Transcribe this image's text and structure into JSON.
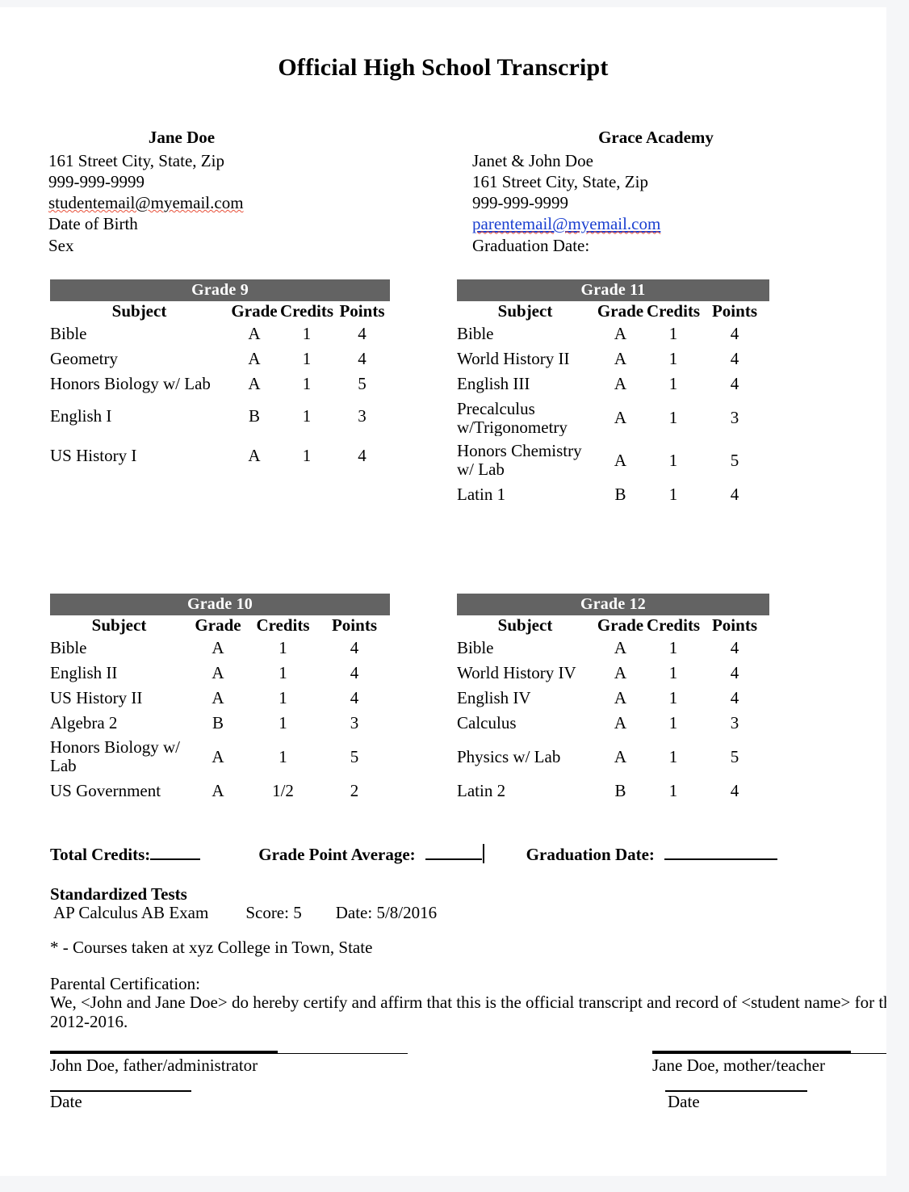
{
  "document": {
    "title": "Official High School Transcript"
  },
  "student": {
    "name": "Jane Doe",
    "address": "161 Street  City, State, Zip",
    "phone": "999-999-9999",
    "email": "studentemail@myemail.com",
    "dob_label": "Date of Birth",
    "sex_label": "Sex"
  },
  "school": {
    "name": "Grace Academy",
    "parents": "Janet & John Doe",
    "address": "161 Street  City, State, Zip",
    "phone": "999-999-9999",
    "email": "parentemail@myemail.com",
    "graduation_label": "Graduation Date:"
  },
  "columns": {
    "subject": "Subject",
    "grade": "Grade",
    "credits": "Credits",
    "points": "Points"
  },
  "grade9": {
    "title": "Grade 9",
    "rows": [
      {
        "subject": "Bible",
        "grade": "A",
        "credits": "1",
        "points": "4"
      },
      {
        "subject": "Geometry",
        "grade": "A",
        "credits": "1",
        "points": "4"
      },
      {
        "subject": "Honors Biology w/ Lab",
        "grade": "A",
        "credits": "1",
        "points": "5"
      },
      {
        "subject": "English I",
        "grade": "B",
        "credits": "1",
        "points": "3"
      },
      {
        "subject": "",
        "grade": "",
        "credits": "",
        "points": ""
      },
      {
        "subject": "US History I",
        "grade": "A",
        "credits": "1",
        "points": "4"
      }
    ]
  },
  "grade10": {
    "title": "Grade 10",
    "rows": [
      {
        "subject": "Bible",
        "grade": "A",
        "credits": "1",
        "points": "4"
      },
      {
        "subject": "English II",
        "grade": "A",
        "credits": "1",
        "points": "4"
      },
      {
        "subject": "US History II",
        "grade": "A",
        "credits": "1",
        "points": "4"
      },
      {
        "subject": "Algebra 2",
        "grade": "B",
        "credits": "1",
        "points": "3"
      },
      {
        "subject": "Honors Biology w/ Lab",
        "grade": "A",
        "credits": "1",
        "points": "5"
      },
      {
        "subject": "US Government",
        "grade": "A",
        "credits": "1/2",
        "points": "2"
      }
    ]
  },
  "grade11": {
    "title": "Grade 11",
    "rows": [
      {
        "subject": "Bible",
        "grade": "A",
        "credits": "1",
        "points": "4"
      },
      {
        "subject": "World History II",
        "grade": "A",
        "credits": "1",
        "points": "4"
      },
      {
        "subject": " English III",
        "grade": "A",
        "credits": "1",
        "points": "4"
      },
      {
        "subject": "Precalculus w/Trigonometry",
        "grade": "A",
        "credits": "1",
        "points": "3"
      },
      {
        "subject": "Honors Chemistry w/ Lab",
        "grade": "A",
        "credits": "1",
        "points": "5"
      },
      {
        "subject": "Latin 1",
        "grade": "B",
        "credits": "1",
        "points": "4"
      }
    ]
  },
  "grade12": {
    "title": "Grade 12",
    "rows": [
      {
        "subject": "Bible",
        "grade": "A",
        "credits": "1",
        "points": "4"
      },
      {
        "subject": "World History IV",
        "grade": "A",
        "credits": "1",
        "points": "4"
      },
      {
        "subject": " English IV",
        "grade": "A",
        "credits": "1",
        "points": "4"
      },
      {
        "subject": "Calculus",
        "grade": "A",
        "credits": "1",
        "points": "3"
      },
      {
        "subject": "Physics  w/ Lab",
        "grade": "A",
        "credits": "1",
        "points": "5"
      },
      {
        "subject": "Latin 2",
        "grade": "B",
        "credits": "1",
        "points": "4"
      }
    ]
  },
  "totals": {
    "credits_label": "Total Credits:",
    "credits_value": "",
    "gpa_label": "Grade Point Average:",
    "gpa_value": "",
    "graduation_label": "Graduation Date:",
    "graduation_value": ""
  },
  "standardized": {
    "heading": "Standardized Tests",
    "exam": "AP Calculus AB Exam",
    "score": "Score: 5",
    "date": "Date: 5/8/2016"
  },
  "footnote": "*  - Courses taken at xyz College in Town, State",
  "certification": {
    "heading": "Parental Certification:",
    "line1": "We, <John and Jane Doe> do hereby certify and affirm that this is the official transcript and record of <student name> for the school years",
    "line2": "2012-2016."
  },
  "signatures": {
    "father": "John Doe, father/administrator",
    "mother": "Jane Doe, mother/teacher",
    "date_left": "Date",
    "date_right": "Date"
  }
}
